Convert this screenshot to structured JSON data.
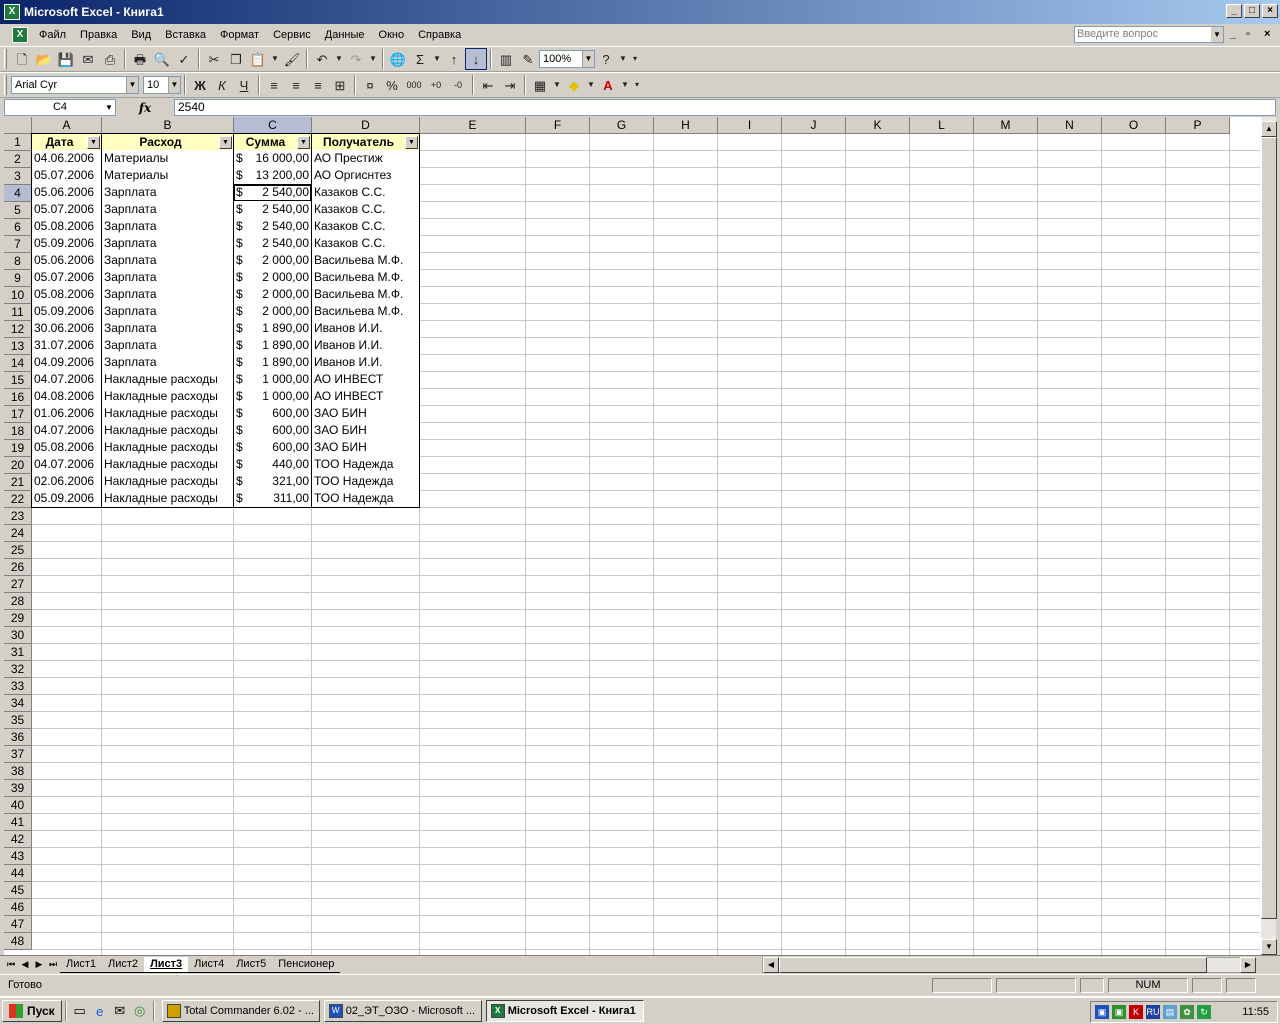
{
  "window": {
    "title": "Microsoft Excel - Книга1",
    "app_icon": "X"
  },
  "menu": {
    "items": [
      "Файл",
      "Правка",
      "Вид",
      "Вставка",
      "Формат",
      "Сервис",
      "Данные",
      "Окно",
      "Справка"
    ],
    "ask_placeholder": "Введите вопрос"
  },
  "toolbar": {
    "zoom": "100%",
    "font_name": "Arial Cyr",
    "font_size": "10"
  },
  "formula_bar": {
    "name_box": "C4",
    "fx": "fx",
    "formula": "2540"
  },
  "columns": [
    "A",
    "B",
    "C",
    "D",
    "E",
    "F",
    "G",
    "H",
    "I",
    "J",
    "K",
    "L",
    "M",
    "N",
    "O",
    "P"
  ],
  "rows": [
    "1",
    "2",
    "3",
    "4",
    "5",
    "6",
    "7",
    "8",
    "9",
    "10",
    "11",
    "12",
    "13",
    "14",
    "15",
    "16",
    "17",
    "18",
    "19",
    "20",
    "21",
    "22",
    "23",
    "24",
    "25",
    "26",
    "27",
    "28",
    "29",
    "30",
    "31",
    "32",
    "33",
    "34",
    "35",
    "36",
    "37",
    "38",
    "39",
    "40",
    "41",
    "42",
    "43",
    "44",
    "45",
    "46",
    "47",
    "48"
  ],
  "table": {
    "headers": [
      "Дата",
      "Расход",
      "Сумма",
      "Получатель"
    ],
    "currency": "$",
    "rows": [
      [
        "04.06.2006",
        "Материалы",
        "16 000,00",
        "АО Престиж"
      ],
      [
        "05.07.2006",
        "Материалы",
        "13 200,00",
        "АО Оргиснтез"
      ],
      [
        "05.06.2006",
        "Зарплата",
        "2 540,00",
        "Казаков С.С."
      ],
      [
        "05.07.2006",
        "Зарплата",
        "2 540,00",
        "Казаков С.С."
      ],
      [
        "05.08.2006",
        "Зарплата",
        "2 540,00",
        "Казаков С.С."
      ],
      [
        "05.09.2006",
        "Зарплата",
        "2 540,00",
        "Казаков С.С."
      ],
      [
        "05.06.2006",
        "Зарплата",
        "2 000,00",
        "Васильева М.Ф."
      ],
      [
        "05.07.2006",
        "Зарплата",
        "2 000,00",
        "Васильева М.Ф."
      ],
      [
        "05.08.2006",
        "Зарплата",
        "2 000,00",
        "Васильева М.Ф."
      ],
      [
        "05.09.2006",
        "Зарплата",
        "2 000,00",
        "Васильева М.Ф."
      ],
      [
        "30.06.2006",
        "Зарплата",
        "1 890,00",
        "Иванов И.И."
      ],
      [
        "31.07.2006",
        "Зарплата",
        "1 890,00",
        "Иванов И.И."
      ],
      [
        "04.09.2006",
        "Зарплата",
        "1 890,00",
        "Иванов И.И."
      ],
      [
        "04.07.2006",
        "Накладные расходы",
        "1 000,00",
        "АО ИНВЕСТ"
      ],
      [
        "04.08.2006",
        "Накладные расходы",
        "1 000,00",
        "АО ИНВЕСТ"
      ],
      [
        "01.06.2006",
        "Накладные расходы",
        "600,00",
        "ЗАО БИН"
      ],
      [
        "04.07.2006",
        "Накладные расходы",
        "600,00",
        "ЗАО БИН"
      ],
      [
        "05.08.2006",
        "Накладные расходы",
        "600,00",
        "ЗАО БИН"
      ],
      [
        "04.07.2006",
        "Накладные расходы",
        "440,00",
        "ТОО Надежда"
      ],
      [
        "02.06.2006",
        "Накладные расходы",
        "321,00",
        "ТОО Надежда"
      ],
      [
        "05.09.2006",
        "Накладные расходы",
        "311,00",
        "ТОО Надежда"
      ]
    ]
  },
  "sheets": [
    "Лист1",
    "Лист2",
    "Лист3",
    "Лист4",
    "Лист5",
    "Пенсионер"
  ],
  "active_sheet": "Лист3",
  "status": {
    "text": "Готово",
    "num": "NUM"
  },
  "taskbar": {
    "start": "Пуск",
    "buttons": [
      "Total Commander 6.02 - ...",
      "02_ЭТ_ОЗО - Microsoft ...",
      "Microsoft Excel - Книга1"
    ],
    "lang": "RU",
    "clock": "11:55"
  }
}
